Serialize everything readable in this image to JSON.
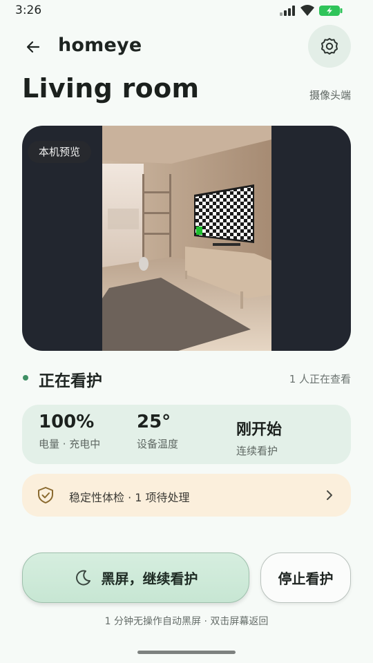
{
  "status_bar": {
    "time": "3:26"
  },
  "header": {
    "app_name": "homeye"
  },
  "room": {
    "title": "Living room",
    "role_label": "摄像头端"
  },
  "preview": {
    "tag": "本机预览"
  },
  "watch": {
    "status": "正在看护",
    "viewers": "1 人正在查看"
  },
  "stats": [
    {
      "value": "100%",
      "label": "电量 · 充电中"
    },
    {
      "value": "25°",
      "label": "设备温度"
    },
    {
      "value": "刚开始",
      "label": "连续看护"
    }
  ],
  "health_check": {
    "label": "稳定性体检 · 1 项待处理"
  },
  "actions": {
    "primary": "黑屏，继续看护",
    "secondary": "停止看护"
  },
  "hint": "1 分钟无操作自动黑屏 · 双击屏幕返回",
  "colors": {
    "accent": "#3f8f64",
    "stats_bg": "#e3f0e8",
    "warning_bg": "#fbefdc",
    "battery": "#2fc45a"
  }
}
